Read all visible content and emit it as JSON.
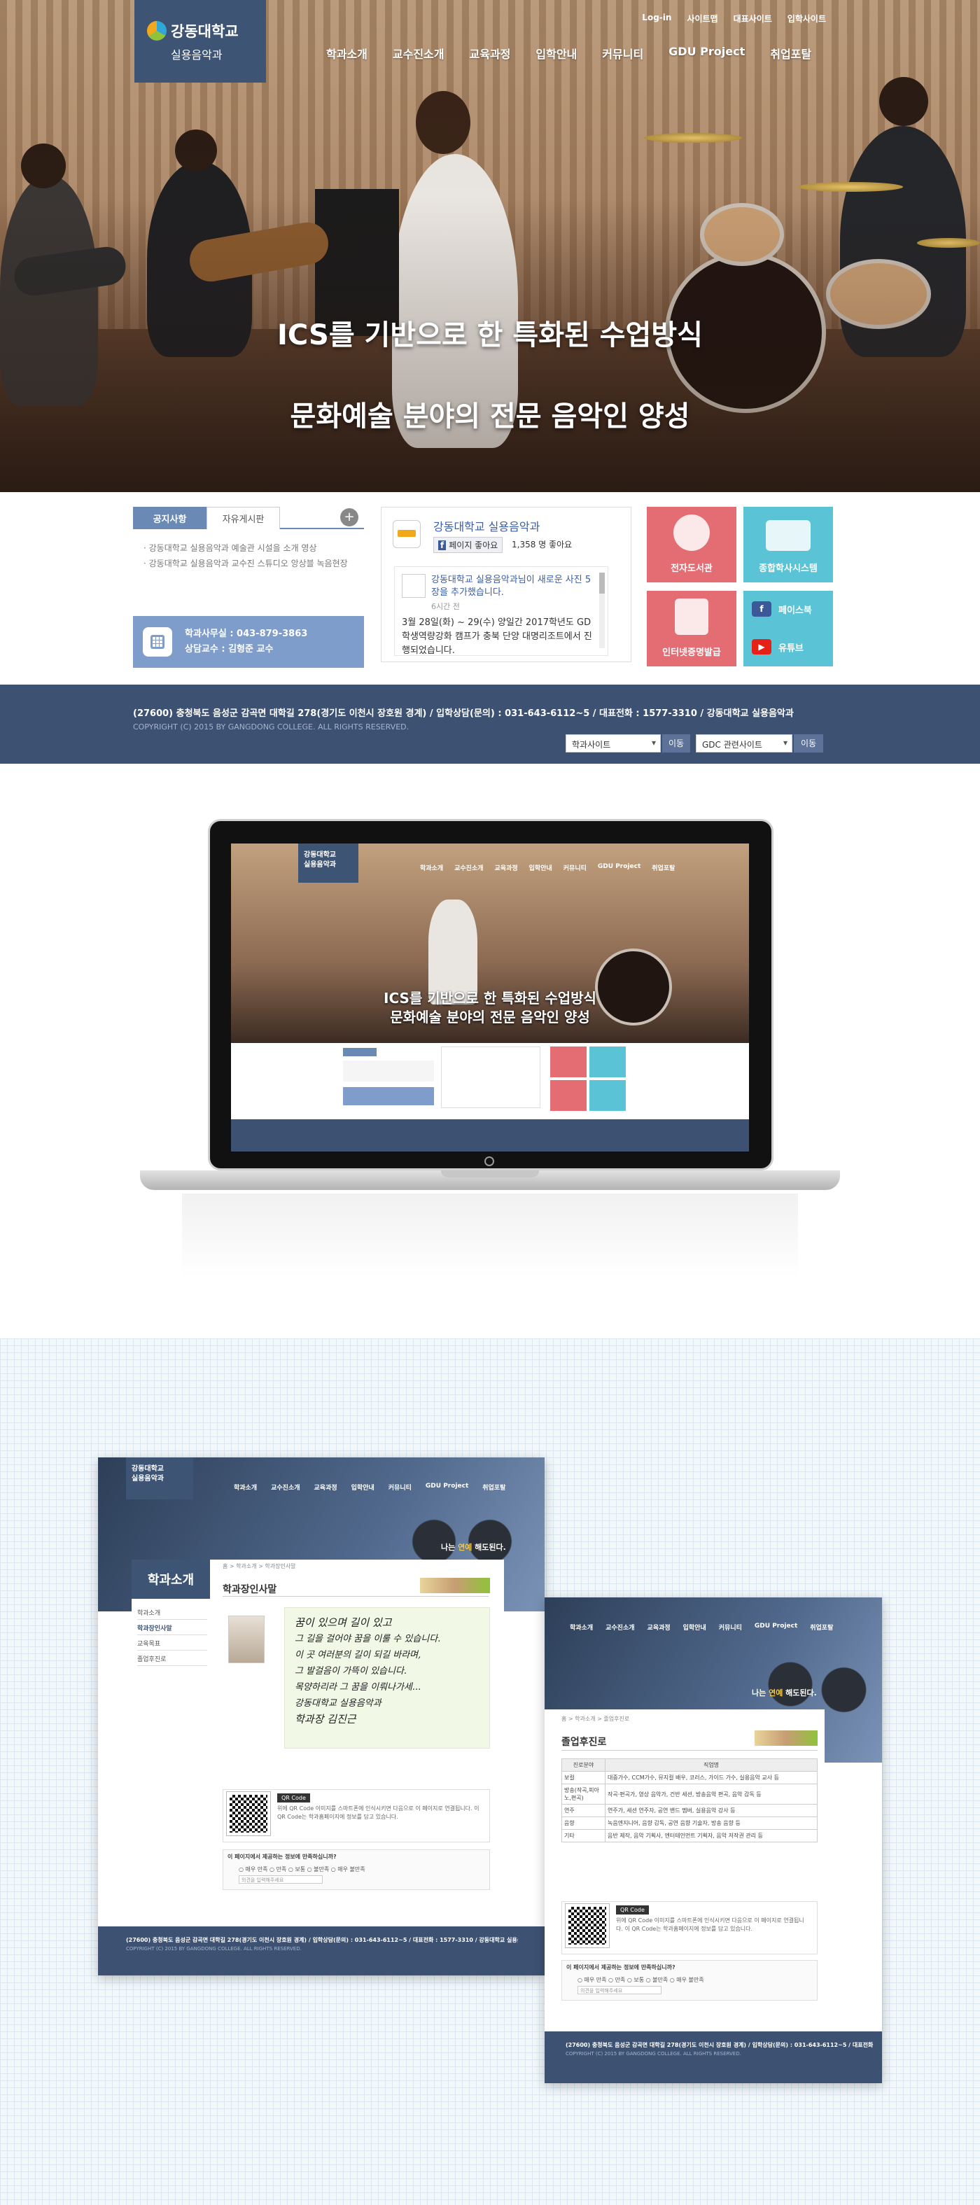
{
  "header": {
    "logo_name": "강동대학교",
    "logo_sub": "실용음악과",
    "util_links": [
      "Log-in",
      "사이트맵",
      "대표사이트",
      "입학사이트"
    ],
    "gnb": [
      "학과소개",
      "교수진소개",
      "교육과정",
      "입학안내",
      "커뮤니티",
      "GDU Project",
      "취업포탈"
    ],
    "hero_line1": "ICS를 기반으로 한 특화된 수업방식",
    "hero_line2": "문화예술 분야의 전문 음악인 양성"
  },
  "board": {
    "tabs": [
      "공지사항",
      "자유게시판"
    ],
    "plus": "+",
    "items": [
      "· 강동대학교 실용음악과 예술관 시설을 소개 영상",
      "· 강동대학교 실용음악과 교수진 스튜디오 앙상블 녹음현장"
    ],
    "contact_line1": "학과사무실 : 043-879-3863",
    "contact_line2": "상담교수 : 김형준 교수"
  },
  "facebook": {
    "page_name": "강동대학교 실용음악과",
    "like_button": "페이지 좋아요",
    "like_count": "1,358 명 좋아요",
    "post_title": "강동대학교 실용음악과님이 새로운 사진 5장을 추가했습니다.",
    "post_time": "6시간 전",
    "post_body": "3월 28일(화) ~ 29(수) 양일간 2017학년도 GD 학생역량강화 캠프가 충북 단양 대명리조트에서 진행되었습니다."
  },
  "quick_links": [
    {
      "label": "전자도서관",
      "color": "#e46c73"
    },
    {
      "label": "종합학사시스템",
      "color": "#5bc3d6"
    },
    {
      "label": "인터넷증명발급",
      "color": "#e46c73"
    }
  ],
  "social": [
    "페이스북",
    "유튜브"
  ],
  "footer": {
    "address": "(27600) 충청북도 음성군 감곡면 대학길 278(경기도 이천시 장호원 경계) / 입학상담(문의) : 031-643-6112~5 / 대표전화 : 1577-3310 / 강동대학교 실용음악과",
    "copyright": "COPYRIGHT (C) 2015 BY GANGDONG COLLEGE. ALL RIGHTS RESERVED.",
    "select1": "학과사이트",
    "select2": "GDC 관련사이트",
    "go": "이동"
  },
  "sub1": {
    "side_title": "학과소개",
    "side_items": [
      "학과소개",
      "학과장인사말",
      "교육목표",
      "졸업후진로"
    ],
    "crumb": "홈 > 학과소개 > 학과장인사말",
    "title": "학과장인사말",
    "slogan_pre": "나는 ",
    "slogan_em": "연예",
    "slogan_post": " 해도된다.",
    "handwriting": [
      "꿈이 있으며 길이 있고",
      "그 길을 걸어야 꿈을 이룰 수 있습니다.",
      "이 곳 여러분의 길이 되길 바라며,",
      "그 발걸음이 가뜩이 있습니다.",
      "목양하리라 그 꿈을 이뤄나가세...",
      "강동대학교 실용음악과",
      "학과장 김진근"
    ],
    "qr_tag": "QR Code",
    "qr_text": "위에 QR Code 이미지를 스마트폰에 인식시키면 다음으로 이 페이지로 연결됩니다. 이 QR Code는 학과홈페이지에 정보를 담고 있습니다.",
    "poll_title": "이 페이지에서 제공하는 정보에 만족하십니까?",
    "poll_options": "○ 매우 만족  ○ 만족  ○ 보통  ○ 불만족  ○ 매우 불만족",
    "poll_input": "의견을 입력해주세요"
  },
  "sub2": {
    "crumb": "홈 > 학과소개 > 졸업후진로",
    "title": "졸업후진로",
    "table_head": [
      "진로분야",
      "직업명"
    ],
    "rows": [
      [
        "보컬",
        "대중가수, CCM가수, 뮤지컬 배우, 코러스, 가이드 가수, 실용음악 교사 등"
      ],
      [
        "방송(작곡,피아노,편곡)",
        "작곡·편곡가, 영상 음악가, 건반 세션, 방송음악 편곡, 음악 감독 등"
      ],
      [
        "연주",
        "연주가, 세션 연주자, 공연 밴드 멤버, 실용음악 강사 등"
      ],
      [
        "음향",
        "녹음엔지니어, 음향 감독, 공연 음향 기술자, 방송 음향 등"
      ],
      [
        "기타",
        "음반 제작, 음악 기획사, 엔터테인먼트 기획자, 음악 저작권 관리 등"
      ]
    ]
  }
}
